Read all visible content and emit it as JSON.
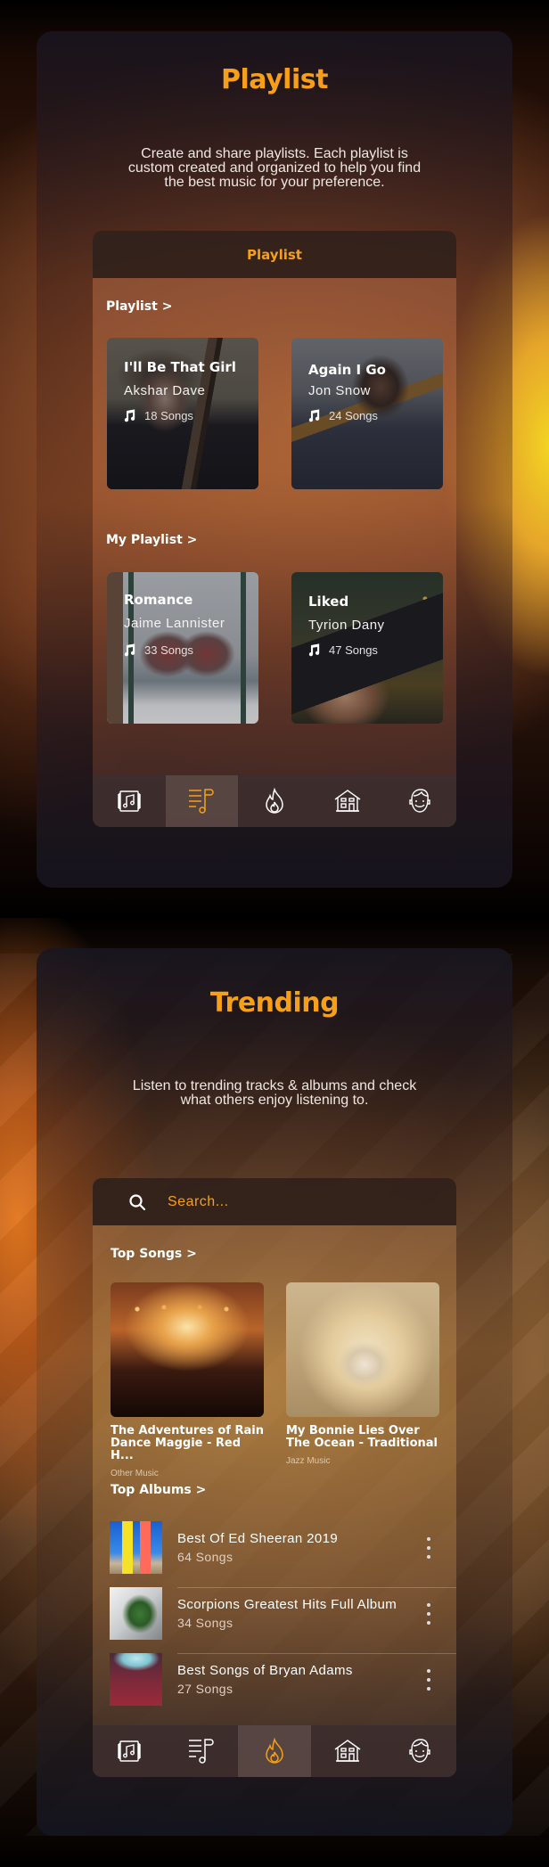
{
  "screens": [
    {
      "title": "Playlist",
      "description": "Create and share playlists. Each playlist is custom created and organized to help you find the best music for your preference.",
      "header_title": "Playlist",
      "sections": [
        {
          "label": "Playlist >",
          "cards": [
            {
              "title": "I'll Be That Girl",
              "artist": "Akshar Dave",
              "songs": "18 Songs"
            },
            {
              "title": "Again I Go",
              "artist": "Jon Snow",
              "songs": "24 Songs"
            }
          ]
        },
        {
          "label": "My Playlist >",
          "cards": [
            {
              "title": "Romance",
              "artist": "Jaime Lannister",
              "songs": "33 Songs"
            },
            {
              "title": "Liked",
              "artist": "Tyrion  Dany",
              "songs": "47 Songs"
            }
          ]
        }
      ],
      "nav": {
        "items": [
          {
            "icon": "album-icon",
            "label": "Albums"
          },
          {
            "icon": "playlist-icon",
            "label": "Playlist"
          },
          {
            "icon": "fire-icon",
            "label": "Trending"
          },
          {
            "icon": "home-icon",
            "label": "Home"
          },
          {
            "icon": "profile-icon",
            "label": "Profile"
          }
        ],
        "active_index": 1
      }
    },
    {
      "title": "Trending",
      "description": "Listen to trending tracks & albums and check what others enjoy listening to.",
      "search": {
        "placeholder": "Search...",
        "value": ""
      },
      "top_songs": {
        "label": "Top Songs >",
        "items": [
          {
            "title": "The Adventures of Rain Dance Maggie - Red H...",
            "genre": "Other Music"
          },
          {
            "title": "My Bonnie Lies Over The Ocean - Traditional",
            "genre": "Jazz Music"
          }
        ]
      },
      "top_albums": {
        "label": "Top Albums >",
        "items": [
          {
            "title": "Best Of Ed Sheeran 2019",
            "songs": "64 Songs"
          },
          {
            "title": "Scorpions Greatest Hits Full Album",
            "songs": "34 Songs"
          },
          {
            "title": "Best Songs of Bryan Adams",
            "songs": "27 Songs"
          }
        ]
      },
      "nav": {
        "items": [
          {
            "icon": "album-icon",
            "label": "Albums"
          },
          {
            "icon": "playlist-icon",
            "label": "Playlist"
          },
          {
            "icon": "fire-icon",
            "label": "Trending"
          },
          {
            "icon": "home-icon",
            "label": "Home"
          },
          {
            "icon": "profile-icon",
            "label": "Profile"
          }
        ],
        "active_index": 2
      }
    }
  ],
  "colors": {
    "accent": "#f7a017",
    "icon_default": "#ffffff",
    "background": "#000000"
  }
}
